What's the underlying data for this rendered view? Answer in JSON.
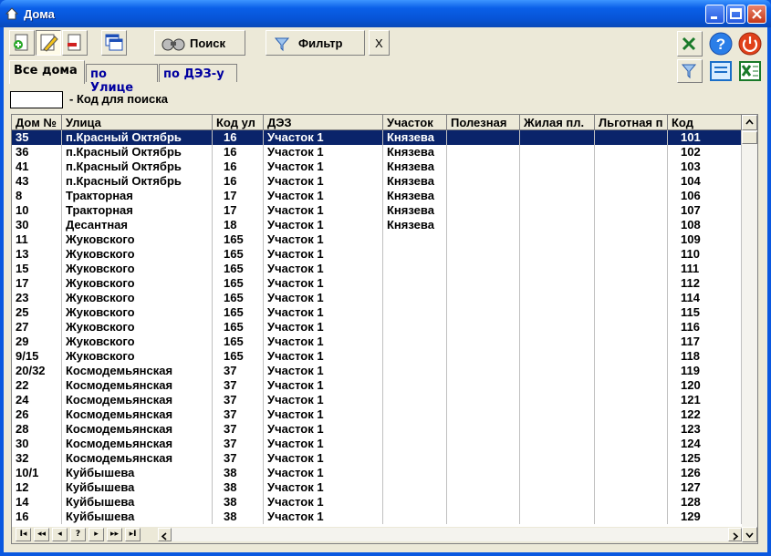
{
  "window": {
    "title": "Дома"
  },
  "toolbar": {
    "search_label": "Поиск",
    "filter_label": "Фильтр",
    "clear_label": "X"
  },
  "tabs": [
    {
      "label": "Все дома"
    },
    {
      "label": "по Улице"
    },
    {
      "label": "по ДЭЗ-у"
    }
  ],
  "search": {
    "label": "- Код для поиска",
    "value": ""
  },
  "table": {
    "columns": [
      "Дом №",
      "Улица",
      "Код ул",
      "ДЭЗ",
      "Участок",
      "Полезная",
      "Жилая пл.",
      "Льготная п",
      "Код"
    ],
    "rows": [
      [
        "35",
        "п.Красный Октябрь",
        "16",
        "Участок 1",
        "Князева",
        "",
        "",
        "",
        "101"
      ],
      [
        "36",
        "п.Красный Октябрь",
        "16",
        "Участок 1",
        "Князева",
        "",
        "",
        "",
        "102"
      ],
      [
        "41",
        "п.Красный Октябрь",
        "16",
        "Участок 1",
        "Князева",
        "",
        "",
        "",
        "103"
      ],
      [
        "43",
        "п.Красный Октябрь",
        "16",
        "Участок 1",
        "Князева",
        "",
        "",
        "",
        "104"
      ],
      [
        "8",
        "Тракторная",
        "17",
        "Участок 1",
        "Князева",
        "",
        "",
        "",
        "106"
      ],
      [
        "10",
        "Тракторная",
        "17",
        "Участок 1",
        "Князева",
        "",
        "",
        "",
        "107"
      ],
      [
        "30",
        "Десантная",
        "18",
        "Участок 1",
        "Князева",
        "",
        "",
        "",
        "108"
      ],
      [
        "11",
        "Жуковского",
        "165",
        "Участок 1",
        "",
        "",
        "",
        "",
        "109"
      ],
      [
        "13",
        "Жуковского",
        "165",
        "Участок 1",
        "",
        "",
        "",
        "",
        "110"
      ],
      [
        "15",
        "Жуковского",
        "165",
        "Участок 1",
        "",
        "",
        "",
        "",
        "111"
      ],
      [
        "17",
        "Жуковского",
        "165",
        "Участок 1",
        "",
        "",
        "",
        "",
        "112"
      ],
      [
        "23",
        "Жуковского",
        "165",
        "Участок 1",
        "",
        "",
        "",
        "",
        "114"
      ],
      [
        "25",
        "Жуковского",
        "165",
        "Участок 1",
        "",
        "",
        "",
        "",
        "115"
      ],
      [
        "27",
        "Жуковского",
        "165",
        "Участок 1",
        "",
        "",
        "",
        "",
        "116"
      ],
      [
        "29",
        "Жуковского",
        "165",
        "Участок 1",
        "",
        "",
        "",
        "",
        "117"
      ],
      [
        "9/15",
        "Жуковского",
        "165",
        "Участок 1",
        "",
        "",
        "",
        "",
        "118"
      ],
      [
        "20/32",
        "Космодемьянская",
        "37",
        "Участок 1",
        "",
        "",
        "",
        "",
        "119"
      ],
      [
        "22",
        "Космодемьянская",
        "37",
        "Участок 1",
        "",
        "",
        "",
        "",
        "120"
      ],
      [
        "24",
        "Космодемьянская",
        "37",
        "Участок 1",
        "",
        "",
        "",
        "",
        "121"
      ],
      [
        "26",
        "Космодемьянская",
        "37",
        "Участок 1",
        "",
        "",
        "",
        "",
        "122"
      ],
      [
        "28",
        "Космодемьянская",
        "37",
        "Участок 1",
        "",
        "",
        "",
        "",
        "123"
      ],
      [
        "30",
        "Космодемьянская",
        "37",
        "Участок 1",
        "",
        "",
        "",
        "",
        "124"
      ],
      [
        "32",
        "Космодемьянская",
        "37",
        "Участок 1",
        "",
        "",
        "",
        "",
        "125"
      ],
      [
        "10/1",
        "Куйбышева",
        "38",
        "Участок 1",
        "",
        "",
        "",
        "",
        "126"
      ],
      [
        "12",
        "Куйбышева",
        "38",
        "Участок 1",
        "",
        "",
        "",
        "",
        "127"
      ],
      [
        "14",
        "Куйбышева",
        "38",
        "Участок 1",
        "",
        "",
        "",
        "",
        "128"
      ],
      [
        "16",
        "Куйбышева",
        "38",
        "Участок 1",
        "",
        "",
        "",
        "",
        "129"
      ]
    ]
  },
  "navigator": [
    "I◂",
    "◂◂",
    "◂",
    "?",
    "▸",
    "▸▸",
    "▸I"
  ]
}
